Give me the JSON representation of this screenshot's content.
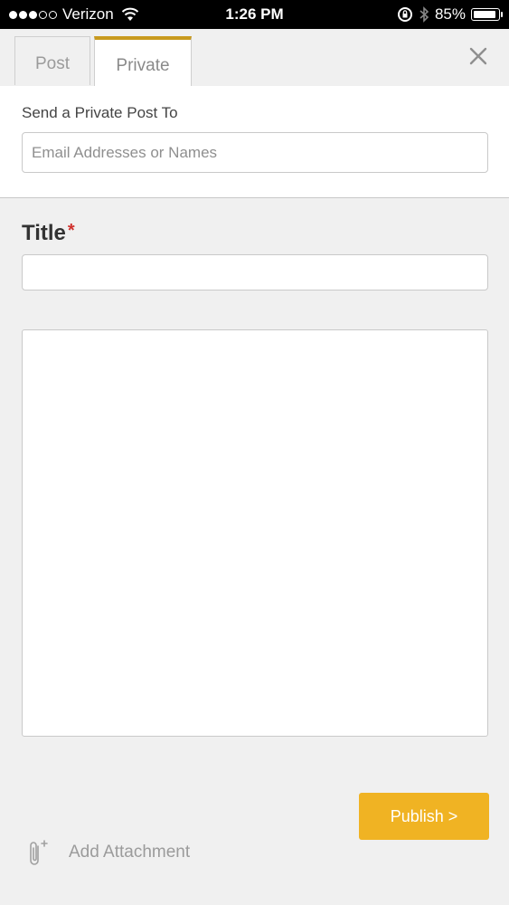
{
  "status_bar": {
    "carrier": "Verizon",
    "time": "1:26 PM",
    "battery": "85%"
  },
  "tabs": [
    {
      "label": "Post",
      "active": false
    },
    {
      "label": "Private",
      "active": true
    }
  ],
  "recipients": {
    "label": "Send a Private Post To",
    "placeholder": "Email Addresses or Names",
    "value": ""
  },
  "title_field": {
    "label": "Title",
    "required_mark": "*",
    "value": ""
  },
  "body_field": {
    "value": ""
  },
  "actions": {
    "publish_label": "Publish >",
    "attachment_label": "Add Attachment"
  },
  "colors": {
    "accent": "#f0b323",
    "tab_highlight": "#c89a1e",
    "required": "#d0312d"
  },
  "icons": {
    "close": "close-icon",
    "attachment": "paperclip-icon",
    "wifi": "wifi-icon",
    "bluetooth": "bluetooth-icon",
    "rotation_lock": "rotation-lock-icon",
    "battery": "battery-icon"
  }
}
